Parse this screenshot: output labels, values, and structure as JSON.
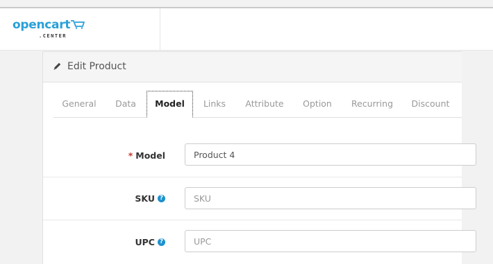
{
  "header": {
    "logo_text": "opencart",
    "logo_sub": ".CENTER",
    "logo_color": "#29a0d8"
  },
  "panel": {
    "title": "Edit Product",
    "title_icon": "pencil-icon"
  },
  "tabs": [
    {
      "label": "General",
      "active": false
    },
    {
      "label": "Data",
      "active": false
    },
    {
      "label": "Model",
      "active": true
    },
    {
      "label": "Links",
      "active": false
    },
    {
      "label": "Attribute",
      "active": false
    },
    {
      "label": "Option",
      "active": false
    },
    {
      "label": "Recurring",
      "active": false
    },
    {
      "label": "Discount",
      "active": false
    }
  ],
  "form": {
    "model": {
      "label": "Model",
      "required_mark": "*",
      "value": "Product 4",
      "placeholder": "Model"
    },
    "sku": {
      "label": "SKU",
      "value": "",
      "placeholder": "SKU",
      "help_icon": "question-circle-icon"
    },
    "upc": {
      "label": "UPC",
      "value": "",
      "placeholder": "UPC",
      "help_icon": "question-circle-icon"
    }
  },
  "colors": {
    "required": "#c0392b",
    "help": "#1e91cf"
  }
}
